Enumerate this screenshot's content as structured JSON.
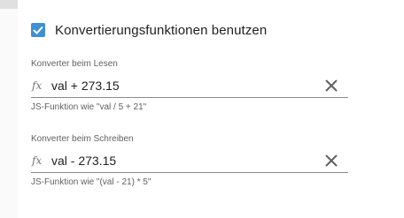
{
  "checkbox": {
    "label": "Konvertierungsfunktionen benutzen",
    "checked": true,
    "color": "#3f8fd4"
  },
  "read_converter": {
    "label": "Konverter beim Lesen",
    "icon": "function-icon",
    "icon_text": "fx",
    "value": "val + 273.15",
    "helper": "JS-Funktion wie \"val / 5 + 21\""
  },
  "write_converter": {
    "label": "Konverter beim Schreiben",
    "icon": "function-icon",
    "icon_text": "fx",
    "value": "val - 273.15",
    "helper": "JS-Funktion wie \"(val - 21) * 5\""
  }
}
